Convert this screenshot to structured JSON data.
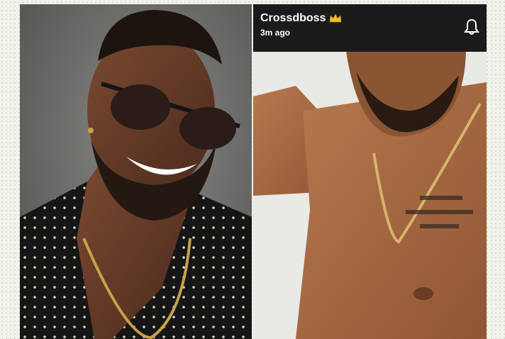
{
  "story": {
    "username": "Crossdboss",
    "time": "3m ago"
  },
  "icons": {
    "badge": "crown-emoji",
    "notification": "bell-icon"
  },
  "colors": {
    "header_bg": "#1b1b1b",
    "header_text": "#ffffff",
    "crown": "#f2c12e"
  }
}
